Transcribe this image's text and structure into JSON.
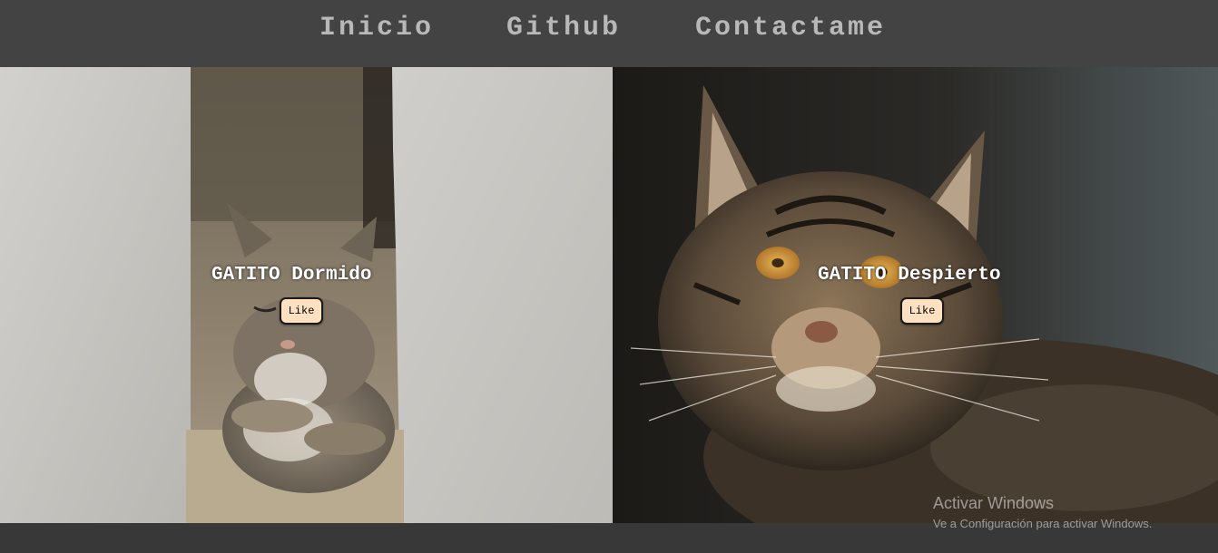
{
  "nav": {
    "items": [
      {
        "label": "Inicio"
      },
      {
        "label": "Github"
      },
      {
        "label": "Contactame"
      }
    ]
  },
  "cards": [
    {
      "title": "GATITO Dormido",
      "like_label": "Like"
    },
    {
      "title": "GATITO Despierto",
      "like_label": "Like"
    }
  ],
  "os_watermark": {
    "title": "Activar Windows",
    "subtitle": "Ve a Configuración para activar Windows."
  },
  "colors": {
    "nav_background": "#434343",
    "nav_text": "#b8b8b8",
    "like_button_background": "#ffe1c2",
    "page_background": "#3a3a3a"
  }
}
